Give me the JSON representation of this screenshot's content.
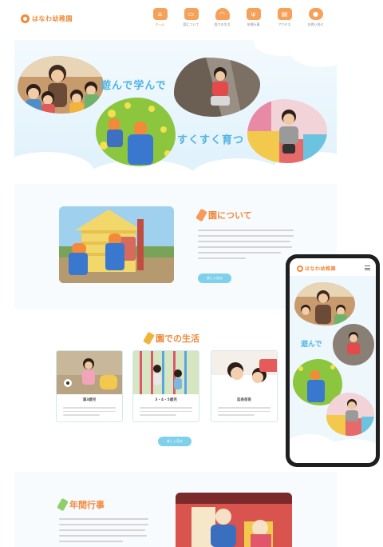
{
  "brand": {
    "name": "はなわ幼稚園",
    "accent": "#f28a3a",
    "sky": "#4fb3e2",
    "button": "#7fd0ea"
  },
  "nav": [
    {
      "label": "ホーム",
      "icon": "school-building-icon",
      "active": true
    },
    {
      "label": "園について",
      "icon": "bus-icon",
      "active": false
    },
    {
      "label": "園での生活",
      "icon": "hat-icon",
      "active": false
    },
    {
      "label": "年間行事",
      "icon": "fork-spoon-icon",
      "active": false
    },
    {
      "label": "アクセス",
      "icon": "map-icon",
      "active": false
    },
    {
      "label": "お問い合せ",
      "icon": "duck-icon",
      "active": false
    }
  ],
  "hero": {
    "catch_1": "遊んで学んで",
    "catch_2": "すくすく育つ"
  },
  "about": {
    "title": "園について",
    "button": "詳しく見る"
  },
  "life": {
    "title": "園での生活",
    "button": "詳しく見る",
    "cards": [
      {
        "title": "満3歳児"
      },
      {
        "title": "3・4・5歳児"
      },
      {
        "title": "延長保育"
      }
    ]
  },
  "events": {
    "title": "年間行事"
  },
  "phone": {
    "name": "はなわ幼稚園",
    "catch": "遊んで"
  }
}
